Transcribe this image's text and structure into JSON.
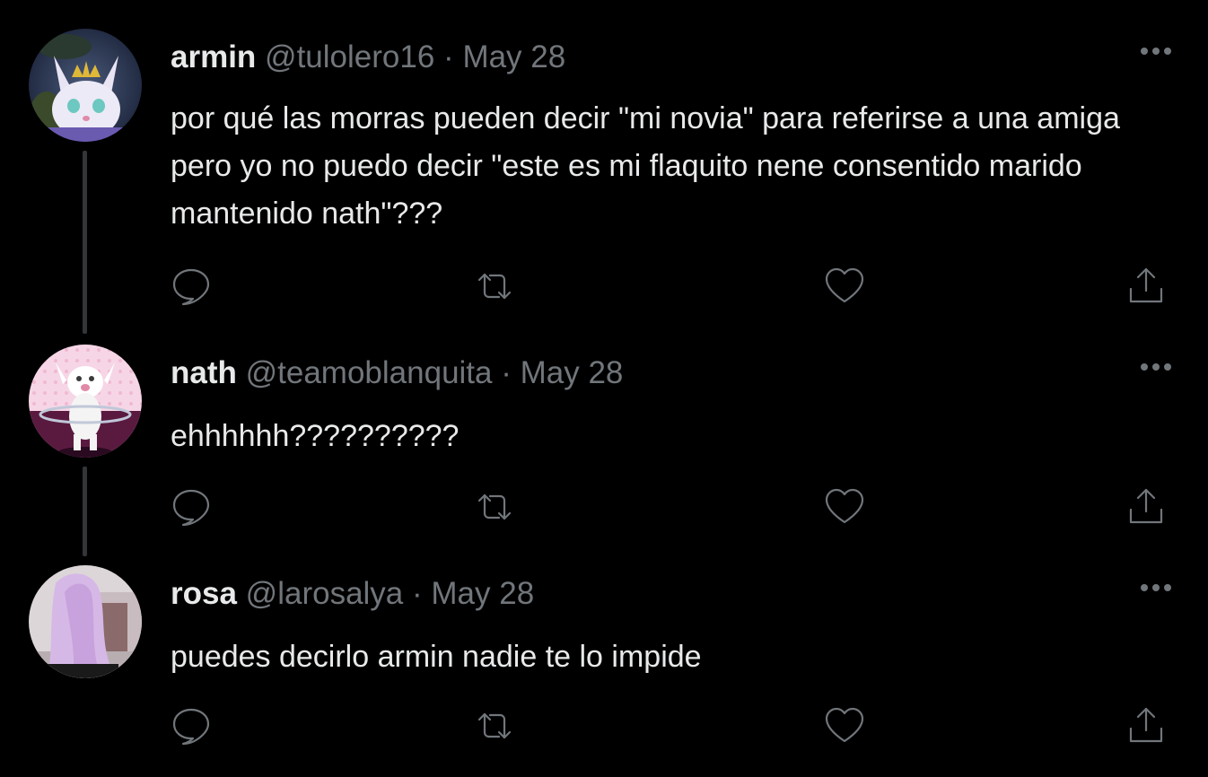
{
  "colors": {
    "background": "#000000",
    "primary_text": "#e7e9ea",
    "secondary_text": "#71767b",
    "thread_line": "#333639"
  },
  "tweets": [
    {
      "name": "armin",
      "handle": "@tulolero16",
      "separator": "·",
      "date": "May 28",
      "text": "por qué las morras pueden decir \"mi novia\" para referirse a una amiga pero yo no puedo decir \"este es mi flaquito nene consentido marido mantenido nath\"???",
      "avatar_icon": "avatar-cat-crown",
      "actions": [
        "reply-icon",
        "retweet-icon",
        "like-icon",
        "share-icon"
      ],
      "more_icon": "more-icon"
    },
    {
      "name": "nath",
      "handle": "@teamoblanquita",
      "separator": "·",
      "date": "May 28",
      "text": "ehhhhhh??????????",
      "avatar_icon": "avatar-white-kitten",
      "actions": [
        "reply-icon",
        "retweet-icon",
        "like-icon",
        "share-icon"
      ],
      "more_icon": "more-icon"
    },
    {
      "name": "rosa",
      "handle": "@larosalya",
      "separator": "·",
      "date": "May 28",
      "text": "puedes decirlo armin nadie te lo impide",
      "avatar_icon": "avatar-pink-hair",
      "actions": [
        "reply-icon",
        "retweet-icon",
        "like-icon",
        "share-icon"
      ],
      "more_icon": "more-icon"
    }
  ]
}
